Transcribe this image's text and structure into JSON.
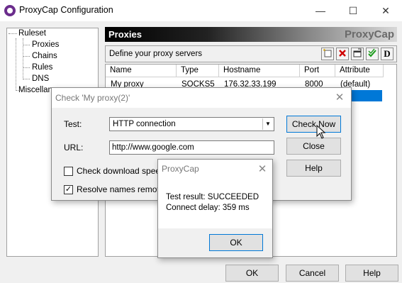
{
  "window": {
    "title": "ProxyCap Configuration",
    "minimize": "—",
    "maximize": "☐",
    "close": "✕"
  },
  "tree": {
    "ruleset": "Ruleset",
    "proxies": "Proxies",
    "chains": "Chains",
    "rules": "Rules",
    "dns": "DNS",
    "misc": "Miscellaneous"
  },
  "panel": {
    "title": "Proxies",
    "brand": "ProxyCap",
    "subtitle": "Define your proxy servers",
    "toolbar": [
      "new-proxy-icon",
      "delete-icon",
      "properties-icon",
      "check-proxy-icon",
      "default-icon"
    ]
  },
  "proxy_table": {
    "columns": [
      "Name",
      "Type",
      "Hostname",
      "Port",
      "Attribute"
    ],
    "rows": [
      {
        "name": "My proxy",
        "type": "SOCKS5",
        "hostname": "176.32.33.199",
        "port": "8000",
        "attribute": "(default)"
      }
    ]
  },
  "main_buttons": {
    "ok": "OK",
    "cancel": "Cancel",
    "help": "Help"
  },
  "check_dialog": {
    "title": "Check 'My proxy(2)'",
    "close": "✕",
    "test_label": "Test:",
    "test_value": "HTTP connection",
    "url_label": "URL:",
    "url_value": "http://www.google.com",
    "check_download_label": "Check download speed",
    "resolve_names_label": "Resolve names remotely",
    "check_download_checked": false,
    "resolve_names_checked": true,
    "check_now": "Check Now",
    "close_button": "Close",
    "help": "Help"
  },
  "result_dialog": {
    "title": "ProxyCap",
    "close": "✕",
    "result": "Test result: SUCCEEDED",
    "delay": "Connect delay: 359 ms",
    "ok": "OK"
  },
  "colors": {
    "selection": "#0078d7",
    "dialog_bg": "#f0f0f0",
    "app_icon": "#6b2d8c"
  }
}
